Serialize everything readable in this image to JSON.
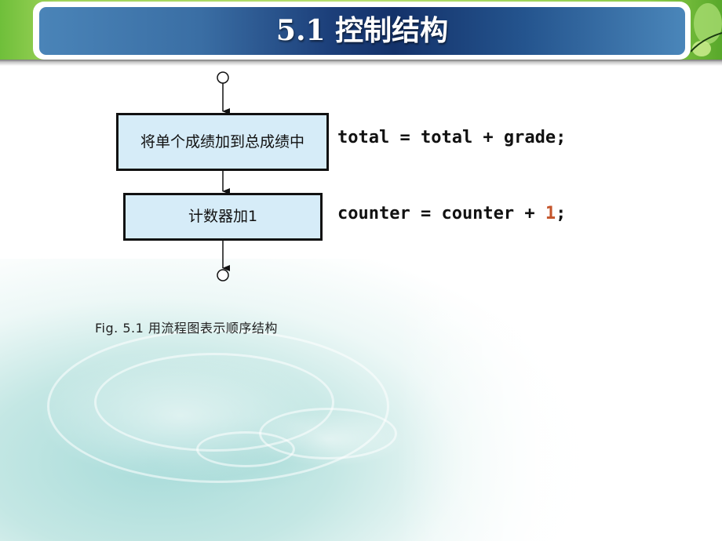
{
  "slide": {
    "title": "5.1   控制结构"
  },
  "flowchart": {
    "start_node": "start-connector",
    "end_node": "end-connector",
    "steps": [
      {
        "label": "将单个成绩加到总成绩中",
        "code": "total = total + grade;"
      },
      {
        "label": "计数器加1",
        "code_before": "counter = counter + ",
        "code_number": "1",
        "code_after": ";"
      }
    ],
    "caption": "Fig. 5.1 用流程图表示顺序结构"
  },
  "colors": {
    "title_bar_dark": "#14326a",
    "title_bar_light": "#4a86ba",
    "box_fill": "#d6ecf8",
    "number_literal": "#c4542a"
  }
}
